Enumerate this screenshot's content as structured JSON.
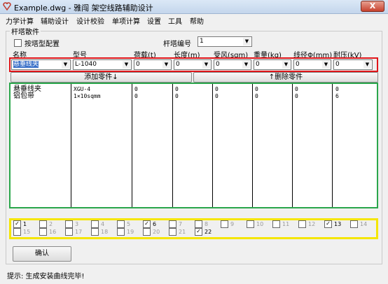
{
  "window": {
    "title": "Example.dwg - 雅闯 架空线路辅助设计",
    "close": "X"
  },
  "menu": [
    "力学计算",
    "辅助设计",
    "设计校验",
    "单项计算",
    "设置",
    "工具",
    "帮助"
  ],
  "group": {
    "title": "杆塔散件"
  },
  "options": {
    "by_tower_type": "按塔型配置",
    "tower_no_label": "杆塔编号",
    "tower_no_value": "1"
  },
  "headers": {
    "name": "名称",
    "model": "型号",
    "load": "荷载(t)",
    "length": "长度(m)",
    "wind": "受风(sqm)",
    "weight": "重量(kg)",
    "wire": "线径Φ(mm)",
    "voltage": "耐压(kV)"
  },
  "inputs": {
    "name": "悬垂线夹",
    "model": "L-1040",
    "load": "0",
    "length": "0",
    "wind": "0",
    "weight": "0",
    "wire": "0",
    "voltage": "0"
  },
  "buttons": {
    "add": "添加零件↓",
    "delete": "↑删除零件",
    "ok": "确认"
  },
  "table": [
    {
      "name": "悬垂线夹",
      "model": "XGU-4",
      "load": "0",
      "length": "0",
      "wind": "0",
      "weight": "0",
      "wire": "0",
      "voltage": "0"
    },
    {
      "name": "铝包带",
      "model": "1×10sqmm",
      "load": "0",
      "length": "0",
      "wind": "0",
      "weight": "0",
      "wire": "0",
      "voltage": "6"
    }
  ],
  "checks_row1": [
    {
      "n": "1",
      "c": true
    },
    {
      "n": "2",
      "c": false
    },
    {
      "n": "3",
      "c": false
    },
    {
      "n": "4",
      "c": false
    },
    {
      "n": "5",
      "c": false
    },
    {
      "n": "6",
      "c": true
    },
    {
      "n": "7",
      "c": false
    },
    {
      "n": "8",
      "c": false
    },
    {
      "n": "9",
      "c": false
    },
    {
      "n": "10",
      "c": false
    },
    {
      "n": "11",
      "c": false
    },
    {
      "n": "12",
      "c": false
    },
    {
      "n": "13",
      "c": true
    },
    {
      "n": "14",
      "c": false
    }
  ],
  "checks_row2": [
    {
      "n": "15",
      "c": false
    },
    {
      "n": "16",
      "c": false
    },
    {
      "n": "17",
      "c": false
    },
    {
      "n": "18",
      "c": false
    },
    {
      "n": "19",
      "c": false
    },
    {
      "n": "20",
      "c": false
    },
    {
      "n": "21",
      "c": false
    },
    {
      "n": "22",
      "c": true
    }
  ],
  "status": "提示: 生成安装曲线完毕!"
}
